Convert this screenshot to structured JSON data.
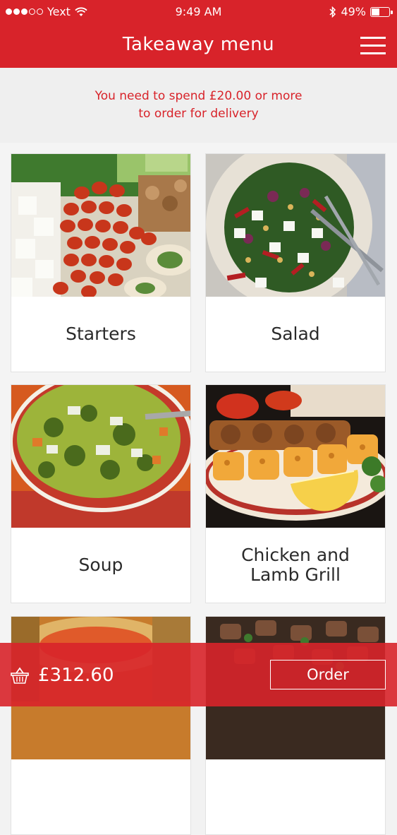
{
  "status_bar": {
    "carrier": "Yext",
    "time": "9:49 AM",
    "battery_percent": "49%",
    "battery_level": 0.49
  },
  "header": {
    "title": "Takeaway menu",
    "menu_icon": "hamburger-icon"
  },
  "notice": {
    "line1": "You need to spend £20.00 or more",
    "line2": "to order for delivery"
  },
  "categories": [
    {
      "label": "Starters"
    },
    {
      "label": "Salad"
    },
    {
      "label": "Soup"
    },
    {
      "label_line1": "Chicken and",
      "label_line2": "Lamb Grill"
    }
  ],
  "basket": {
    "icon": "basket-icon",
    "total": "£312.60",
    "order_label": "Order"
  },
  "colors": {
    "brand_red": "#d8232a",
    "notice_text": "#d8232a",
    "background": "#f2f2f2"
  }
}
